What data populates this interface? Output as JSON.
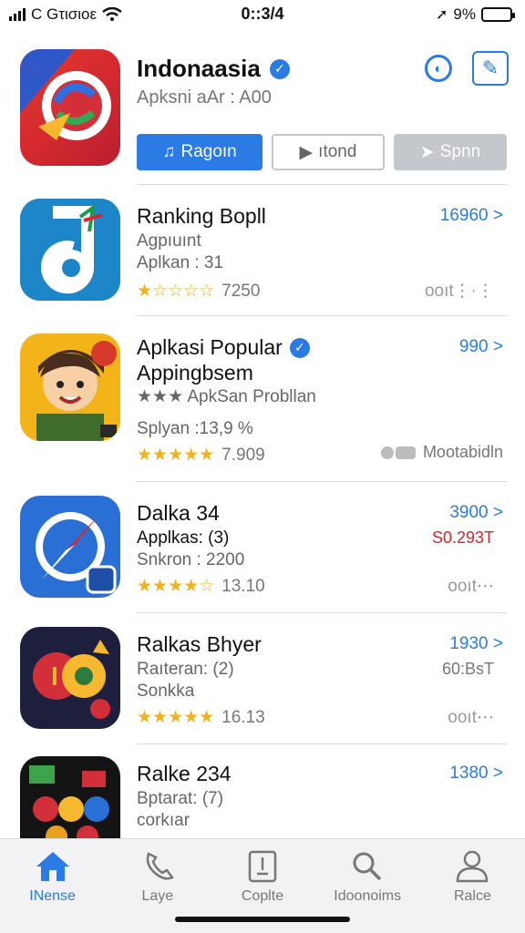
{
  "status": {
    "carrier": "C Gτισιοε",
    "time": "0::3/4",
    "battery": "9%"
  },
  "featured": {
    "title": "Indonaasia",
    "subtitle": "Apksni aAr : A00",
    "buttons": {
      "primary": "Ragoın",
      "outline": "ıtond",
      "grey": "Spnn"
    }
  },
  "apps": [
    {
      "name": "Ranking Bopll",
      "sub1": "Agpıuınt",
      "sub2": "Aplkan : 31",
      "stars": "★☆☆☆☆",
      "rating_count": "7250",
      "price": "16960 >",
      "more": "ooıt⋮·⋮"
    },
    {
      "name": "Aplkasi Popular",
      "name2": "Appingbsem",
      "sub1": "★★★ ApkSan Probllan",
      "sub2": "Splyan :13,9 %",
      "stars": "★★★★★",
      "rating_count": "7.909",
      "price": "990 >",
      "extra": "Mootabidln"
    },
    {
      "name": "Dalka 34",
      "sub1": "Applkas: (3)",
      "sub2": "Snkron : 2200",
      "stars": "★★★★☆",
      "rating_count": "13.10",
      "price": "3900 >",
      "price2": "S0.293T",
      "more": "ooıt⋯"
    },
    {
      "name": "Ralkas Bhyer",
      "sub1": "Raıteran: (2)",
      "sub2": "Sonkka",
      "stars": "★★★★★",
      "rating_count": "16.13",
      "price": "1930 >",
      "price2": "60:BsT",
      "more": "ooıt⋯"
    },
    {
      "name": "Ralke 234",
      "sub1": "Bptarat: (7)",
      "sub2": "corkıar",
      "stars": "★★★★★",
      "rating_count": "",
      "price": "1380 >",
      "more": ""
    }
  ],
  "tabs": [
    {
      "label": "INense",
      "icon": "home-icon"
    },
    {
      "label": "Laye",
      "icon": "phone-icon"
    },
    {
      "label": "Coplte",
      "icon": "document-icon"
    },
    {
      "label": "Idoonoims",
      "icon": "search-icon"
    },
    {
      "label": "Ralce",
      "icon": "profile-icon"
    }
  ],
  "colors": {
    "accent": "#2a7be4",
    "star": "#f2b31a"
  }
}
